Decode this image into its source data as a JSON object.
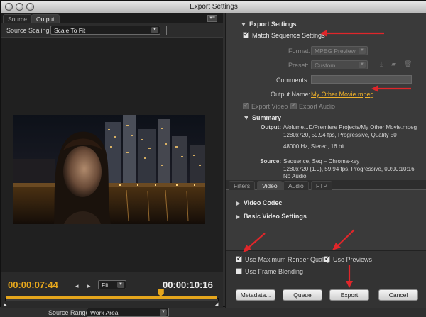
{
  "window": {
    "title": "Export Settings"
  },
  "left": {
    "tabs": [
      {
        "label": "Source"
      },
      {
        "label": "Output"
      }
    ],
    "source_scaling": {
      "label": "Source Scaling:",
      "value": "Scale To Fit"
    },
    "timecode_current": "00:00:07:44",
    "timecode_duration": "00:00:10:16",
    "zoom": "Fit",
    "source_range": {
      "label": "Source Range:",
      "value": "Work Area"
    },
    "playhead_fraction": 0.73
  },
  "export_settings": {
    "heading": "Export Settings",
    "match_sequence": {
      "label": "Match Sequence Settings",
      "checked": true
    },
    "format": {
      "label": "Format:",
      "value": "MPEG Preview"
    },
    "preset": {
      "label": "Preset:",
      "value": "Custom"
    },
    "comments": {
      "label": "Comments:",
      "value": ""
    },
    "output_name": {
      "label": "Output Name:",
      "value": "My Other Movie.mpeg"
    },
    "export_video": {
      "label": "Export Video",
      "checked": true
    },
    "export_audio": {
      "label": "Export Audio",
      "checked": true
    }
  },
  "summary": {
    "heading": "Summary",
    "output_label": "Output:",
    "output_lines": [
      "/Volume...D/Premiere Projects/My Other Movie.mpeg",
      "1280x720, 59.94 fps, Progressive, Quality 50",
      "",
      "48000 Hz, Stereo, 16 bit"
    ],
    "source_label": "Source:",
    "source_lines": [
      "Sequence,  Seq – Chroma-key",
      "1280x720 (1.0), 59.94 fps, Progressive, 00:00:10:16",
      "No Audio"
    ]
  },
  "tabs_right": [
    {
      "label": "Filters"
    },
    {
      "label": "Video"
    },
    {
      "label": "Audio"
    },
    {
      "label": "FTP"
    }
  ],
  "video_sections": [
    {
      "label": "Video Codec"
    },
    {
      "label": "Basic Video Settings"
    }
  ],
  "options": {
    "max_render_quality": {
      "label": "Use Maximum Render Quality",
      "checked": true
    },
    "use_previews": {
      "label": "Use Previews",
      "checked": true
    },
    "frame_blending": {
      "label": "Use Frame Blending",
      "checked": false
    }
  },
  "buttons": {
    "metadata": "Metadata...",
    "queue": "Queue",
    "export": "Export",
    "cancel": "Cancel"
  },
  "colors": {
    "accent_timecode": "#e5a61c",
    "annotation_arrow": "#e0262a",
    "link": "#f0b22a"
  }
}
